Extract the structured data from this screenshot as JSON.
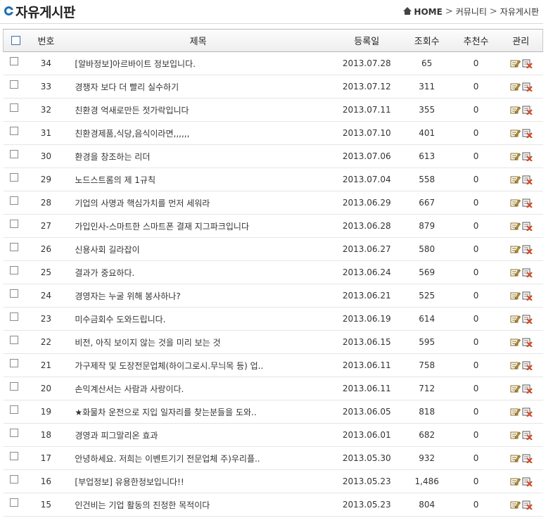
{
  "header": {
    "title": "자유게시판",
    "breadcrumb": {
      "home": "HOME",
      "level1": "커뮤니티",
      "level2": "자유게시판",
      "separator": ">"
    }
  },
  "table": {
    "columns": {
      "num": "번호",
      "subject": "제목",
      "date": "등록일",
      "views": "조회수",
      "recommend": "추천수",
      "manage": "관리"
    },
    "rows": [
      {
        "num": "34",
        "subject": "[알바정보]아르바이트 정보입니다.",
        "date": "2013.07.28",
        "views": "65",
        "recommend": "0"
      },
      {
        "num": "33",
        "subject": "경쟁자 보다 더 빨리 실수하기",
        "date": "2013.07.12",
        "views": "311",
        "recommend": "0"
      },
      {
        "num": "32",
        "subject": "친환경 억새로만든 젓가락입니다",
        "date": "2013.07.11",
        "views": "355",
        "recommend": "0"
      },
      {
        "num": "31",
        "subject": "친환경제품,식당,음식이라면,,,,,,",
        "date": "2013.07.10",
        "views": "401",
        "recommend": "0"
      },
      {
        "num": "30",
        "subject": "환경을 창조하는 리더",
        "date": "2013.07.06",
        "views": "613",
        "recommend": "0"
      },
      {
        "num": "29",
        "subject": "노드스트롬의 제 1규칙",
        "date": "2013.07.04",
        "views": "558",
        "recommend": "0"
      },
      {
        "num": "28",
        "subject": "기업의 사명과 핵심가치를 먼저 세워라",
        "date": "2013.06.29",
        "views": "667",
        "recommend": "0"
      },
      {
        "num": "27",
        "subject": "가입인사-스마트한 스마트폰 결재 지그파크입니다",
        "date": "2013.06.28",
        "views": "879",
        "recommend": "0"
      },
      {
        "num": "26",
        "subject": "신용사회 길라잡이",
        "date": "2013.06.27",
        "views": "580",
        "recommend": "0"
      },
      {
        "num": "25",
        "subject": "결과가 중요하다.",
        "date": "2013.06.24",
        "views": "569",
        "recommend": "0"
      },
      {
        "num": "24",
        "subject": "경영자는 누굴 위해 봉사하나?",
        "date": "2013.06.21",
        "views": "525",
        "recommend": "0"
      },
      {
        "num": "23",
        "subject": "미수금회수 도와드립니다.",
        "date": "2013.06.19",
        "views": "614",
        "recommend": "0"
      },
      {
        "num": "22",
        "subject": "비전, 아직 보이지 않는 것을 미리 보는 것",
        "date": "2013.06.15",
        "views": "595",
        "recommend": "0"
      },
      {
        "num": "21",
        "subject": "가구제작 및 도장전문업체(하이그로시.무늬목 등) 업..",
        "date": "2013.06.11",
        "views": "758",
        "recommend": "0"
      },
      {
        "num": "20",
        "subject": "손익계산서는 사람과 사랑이다.",
        "date": "2013.06.11",
        "views": "712",
        "recommend": "0"
      },
      {
        "num": "19",
        "subject": "★화물차 운전으로 지입 일자리를 찾는분들을 도와..",
        "date": "2013.06.05",
        "views": "818",
        "recommend": "0"
      },
      {
        "num": "18",
        "subject": "경영과 피그말리온 효과",
        "date": "2013.06.01",
        "views": "682",
        "recommend": "0"
      },
      {
        "num": "17",
        "subject": "안녕하세요. 저희는 이벤트기기 전문업체 주)우리플..",
        "date": "2013.05.30",
        "views": "932",
        "recommend": "0"
      },
      {
        "num": "16",
        "subject": "[부업정보] 유용한정보입니다!!",
        "date": "2013.05.23",
        "views": "1,486",
        "recommend": "0"
      },
      {
        "num": "15",
        "subject": "인건비는 기업 활동의 진정한 목적이다",
        "date": "2013.05.23",
        "views": "804",
        "recommend": "0"
      }
    ]
  },
  "icons": {
    "title": "circle-logo-icon",
    "home": "home-icon",
    "edit": "edit-icon",
    "delete": "delete-icon"
  },
  "colors": {
    "accent": "#1d6fb5",
    "edit": "#c9a227",
    "delete": "#d04a2a"
  }
}
